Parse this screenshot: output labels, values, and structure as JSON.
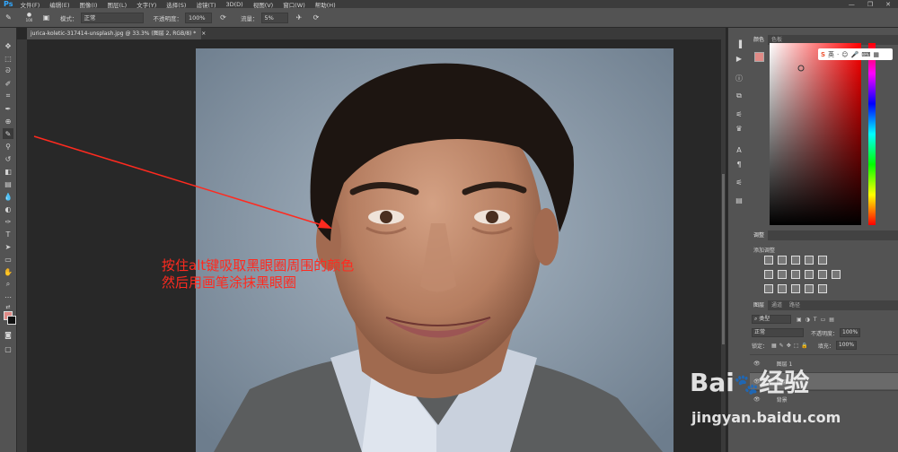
{
  "menubar": {
    "logo": "Ps",
    "items": [
      "文件(F)",
      "编辑(E)",
      "图像(I)",
      "图层(L)",
      "文字(Y)",
      "选择(S)",
      "滤镜(T)",
      "3D(D)",
      "视图(V)",
      "窗口(W)",
      "帮助(H)"
    ],
    "minimize": "—",
    "restore": "❐",
    "close": "✕"
  },
  "options": {
    "brush_size": "100",
    "mode_label": "模式：",
    "mode_value": "正常",
    "opacity_label": "不透明度：",
    "opacity_value": "100%",
    "flow_label": "流量：",
    "flow_value": "5%"
  },
  "document": {
    "tab_title": "jurica-koletic-317414-unsplash.jpg @ 33.3% (图层 2, RGB/8) *",
    "close": "×"
  },
  "annotation": {
    "line1": "按住alt键吸取黑眼圈周围的颜色",
    "line2": "然后用画笔涂抹黑眼圈",
    "color": "#ff2a1f"
  },
  "colors": {
    "foreground": "#e08a86",
    "background": "#111111",
    "accent": "#31a8ff"
  },
  "panels": {
    "color_tab": "颜色",
    "swatches_tab": "色板",
    "adjust_tab": "调整",
    "adjust_add": "添加调整",
    "layers_tab": "图层",
    "channels_tab": "通道",
    "paths_tab": "路径",
    "kind_filter": "类型",
    "blend_mode": "正常",
    "opacity_label": "不透明度：",
    "opacity_value": "100%",
    "lock_label": "锁定：",
    "fill_label": "填充：",
    "fill_value": "100%",
    "layers": [
      "图层 1",
      "图层 2",
      "背景"
    ]
  },
  "sogou": {
    "label": "S",
    "mode": "英"
  },
  "watermark": {
    "brand": "Bai",
    "brand2": "经验",
    "url": "jingyan.baidu.com"
  }
}
